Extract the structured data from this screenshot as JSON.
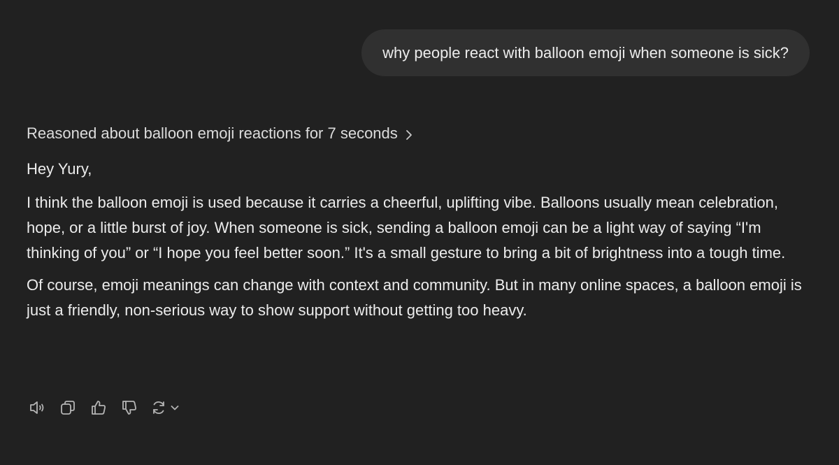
{
  "user_message": {
    "text": "why people react with balloon emoji when someone is sick?"
  },
  "reasoning": {
    "label": "Reasoned about balloon emoji reactions for 7 seconds",
    "icon": "chevron-right-icon"
  },
  "assistant_message": {
    "greeting": "Hey Yury,",
    "paragraphs": [
      "I think the balloon emoji is used because it carries a cheerful, uplifting vibe. Balloons usually mean celebration, hope, or a little burst of joy. When someone is sick, sending a balloon emoji can be a light way of saying “I'm thinking of you” or “I hope you feel better soon.” It's a small gesture to bring a bit of brightness into a tough time.",
      "Of course, emoji meanings can change with context and community. But in many online spaces, a balloon emoji is just a friendly, non-serious way to show support without getting too heavy."
    ]
  },
  "actions": [
    {
      "name": "read-aloud",
      "icon": "speaker-icon"
    },
    {
      "name": "copy",
      "icon": "copy-icon"
    },
    {
      "name": "good-response",
      "icon": "thumbs-up-icon"
    },
    {
      "name": "bad-response",
      "icon": "thumbs-down-icon"
    },
    {
      "name": "regenerate",
      "icon": "refresh-icon"
    }
  ],
  "colors": {
    "background": "#212121",
    "bubble": "#303030",
    "text": "#ececec",
    "icon": "#b4b4b4"
  }
}
